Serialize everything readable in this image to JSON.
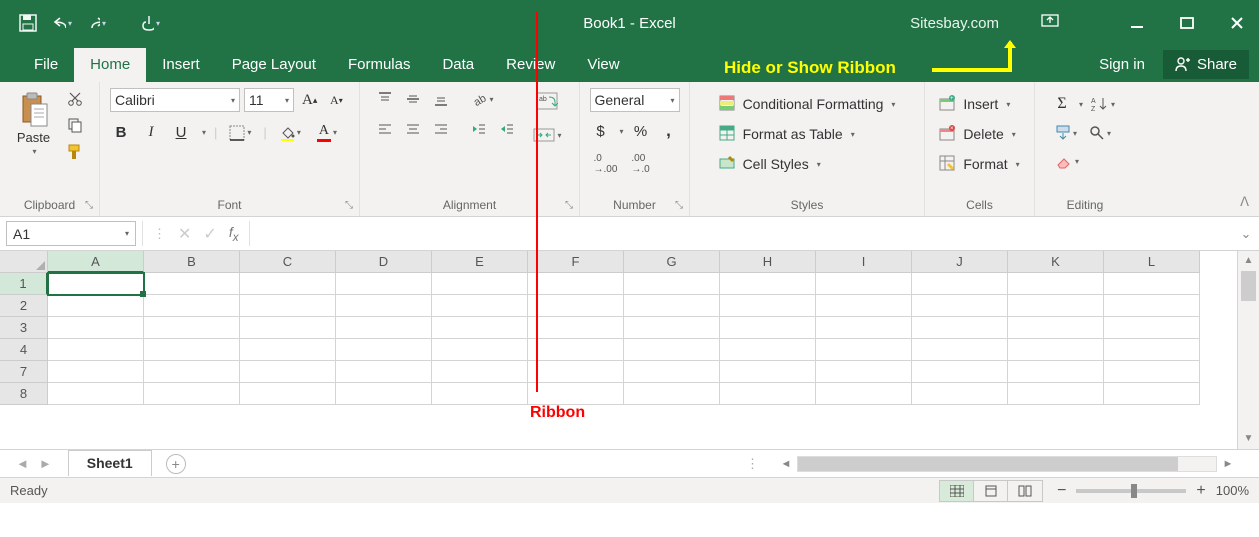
{
  "title": "Book1 - Excel",
  "watermark": "Sitesbay.com",
  "tabs": [
    "File",
    "Home",
    "Insert",
    "Page Layout",
    "Formulas",
    "Data",
    "Review",
    "View"
  ],
  "active_tab": "Home",
  "signin_label": "Sign in",
  "share_label": "Share",
  "annotations": {
    "hide_show": "Hide or Show Ribbon",
    "ribbon": "Ribbon"
  },
  "ribbon": {
    "clipboard": {
      "label": "Clipboard",
      "paste": "Paste"
    },
    "font": {
      "label": "Font",
      "name": "Calibri",
      "size": "11",
      "bold": "B",
      "italic": "I",
      "underline": "U"
    },
    "alignment": {
      "label": "Alignment"
    },
    "number": {
      "label": "Number",
      "format": "General",
      "currency": "$",
      "percent": "%",
      "comma": ",",
      "inc": ".0 .00",
      "dec": ".00 .0"
    },
    "styles": {
      "label": "Styles",
      "cond": "Conditional Formatting",
      "table": "Format as Table",
      "cell": "Cell Styles"
    },
    "cells": {
      "label": "Cells",
      "insert": "Insert",
      "delete": "Delete",
      "format": "Format"
    },
    "editing": {
      "label": "Editing",
      "autosum": "Σ",
      "sort": "A↓Z"
    }
  },
  "namebox": "A1",
  "columns": [
    "A",
    "B",
    "C",
    "D",
    "E",
    "F",
    "G",
    "H",
    "I",
    "J",
    "K",
    "L"
  ],
  "rows": [
    "1",
    "2",
    "3",
    "4",
    "7",
    "8"
  ],
  "active_cell": {
    "row": 0,
    "col": 0
  },
  "sheet": {
    "active": "Sheet1"
  },
  "status": {
    "ready": "Ready",
    "zoom": "100%"
  }
}
